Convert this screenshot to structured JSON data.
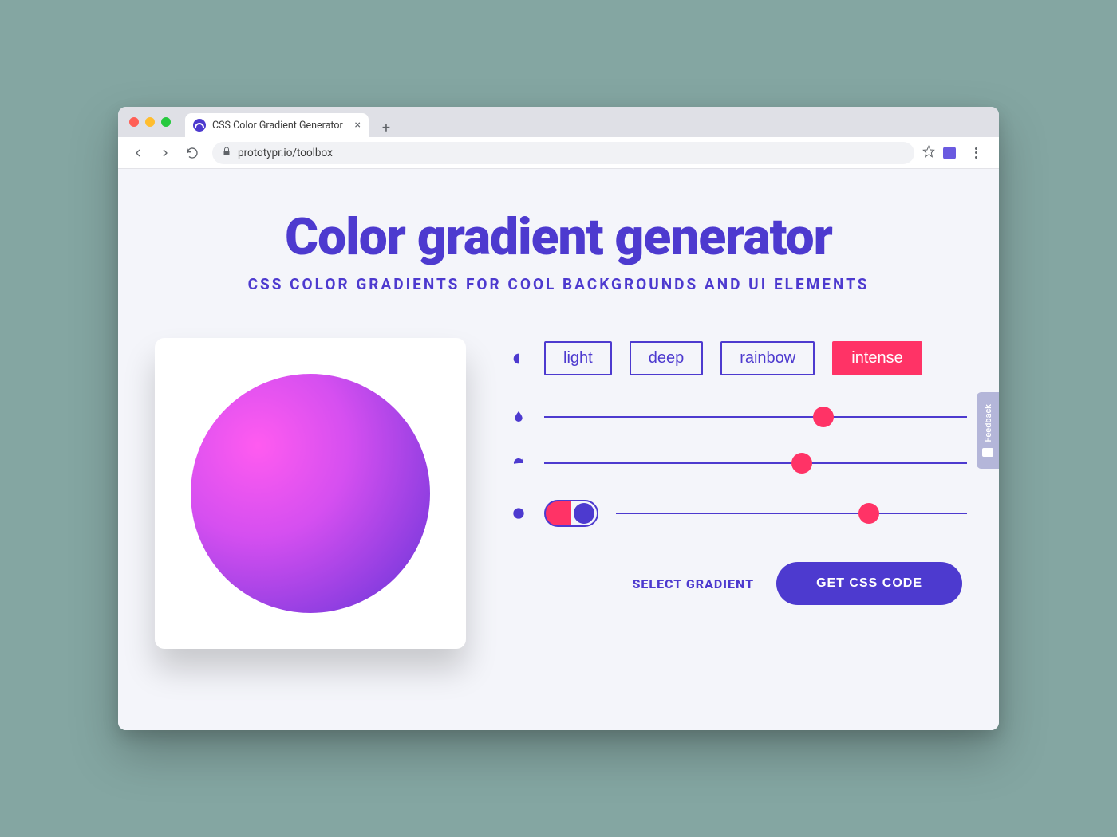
{
  "browser": {
    "tab_title": "CSS Color Gradient Generator",
    "url": "prototypr.io/toolbox"
  },
  "header": {
    "title": "Color gradient generator",
    "subtitle": "CSS COLOR GRADIENTS FOR COOL BACKGROUNDS AND UI ELEMENTS"
  },
  "modes": {
    "options": [
      "light",
      "deep",
      "rainbow",
      "intense"
    ],
    "active_index": 3
  },
  "sliders": {
    "hue_pct": 66,
    "rotate_pct": 61,
    "third_pct": 72
  },
  "toggle": {
    "on": true
  },
  "cta": {
    "select_label": "SELECT GRADIENT",
    "get_css_label": "GET CSS CODE"
  },
  "feedback_label": "Feedback",
  "colors": {
    "primary": "#4d3acf",
    "accent": "#ff3366"
  }
}
